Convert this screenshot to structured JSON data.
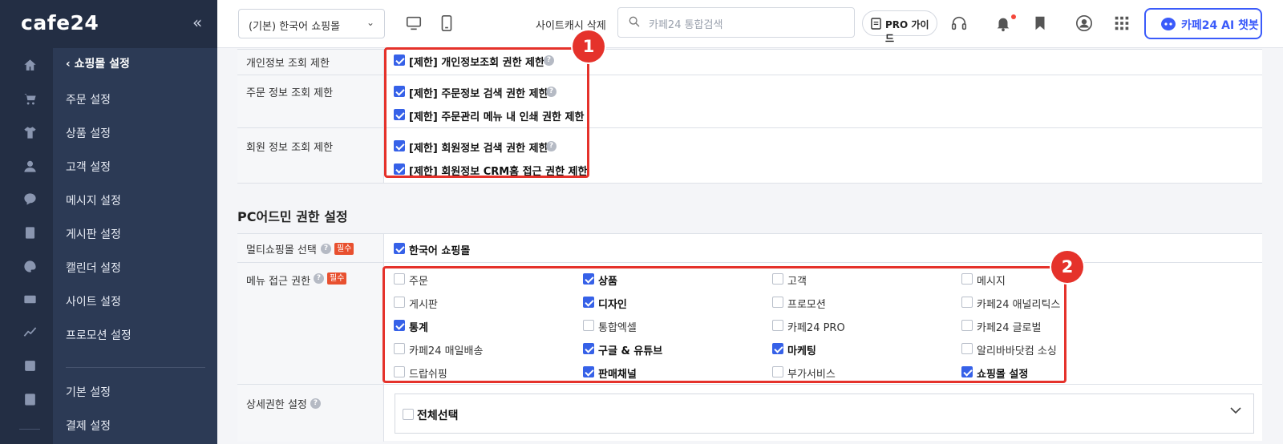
{
  "brand": {
    "logo": "cafe24",
    "collapse": "«"
  },
  "rail_icons": [
    "home-icon",
    "cart-icon",
    "shirt-icon",
    "person-icon",
    "chat-icon",
    "board-icon",
    "palette-icon",
    "promo-icon",
    "chart-line-icon",
    "chart-bar-icon",
    "excel-icon"
  ],
  "sidebar": {
    "back_label": "쇼핑몰 설정",
    "items": [
      "주문 설정",
      "상품 설정",
      "고객 설정",
      "메시지 설정",
      "게시판 설정",
      "캘린더 설정",
      "사이트 설정",
      "프로모션 설정"
    ],
    "items2": [
      "기본 설정",
      "결제 설정"
    ]
  },
  "header": {
    "mall_select": "(기본) 한국어 쇼핑몰",
    "cache_label": "사이트캐시 삭제",
    "search_placeholder": "카페24 통합검색",
    "pro_guide": "PRO 가이드",
    "ai_chatbot": "카페24 AI 챗봇"
  },
  "restriction": {
    "rows": [
      {
        "label": "개인정보 조회 제한",
        "options": [
          {
            "text": "[제한] 개인정보조회 권한 제한",
            "checked": true,
            "help": true
          }
        ]
      },
      {
        "label": "주문 정보 조회 제한",
        "options": [
          {
            "text": "[제한] 주문정보 검색 권한 제한",
            "checked": true,
            "help": true
          },
          {
            "text": "[제한] 주문관리 메뉴 내 인쇄 권한 제한",
            "checked": true,
            "help": false
          }
        ]
      },
      {
        "label": "회원 정보 조회 제한",
        "options": [
          {
            "text": "[제한] 회원정보 검색 권한 제한",
            "checked": true,
            "help": true
          },
          {
            "text": "[제한] 회원정보 CRM홈 접근 권한 제한",
            "checked": true,
            "help": false
          }
        ]
      }
    ]
  },
  "pc_admin": {
    "title": "PC어드민 권한 설정",
    "multi_label": "멀티쇼핑몰 선택",
    "required": "필수",
    "multi_option": "한국어 쇼핑몰",
    "menu_label": "메뉴 접근 권한",
    "menu_options": [
      [
        {
          "text": "주문",
          "checked": false
        },
        {
          "text": "상품",
          "checked": true
        },
        {
          "text": "고객",
          "checked": false
        },
        {
          "text": "메시지",
          "checked": false
        }
      ],
      [
        {
          "text": "게시판",
          "checked": false
        },
        {
          "text": "디자인",
          "checked": true
        },
        {
          "text": "프로모션",
          "checked": false
        },
        {
          "text": "카페24 애널리틱스",
          "checked": false
        }
      ],
      [
        {
          "text": "통계",
          "checked": true
        },
        {
          "text": "통합엑셀",
          "checked": false
        },
        {
          "text": "카페24 PRO",
          "checked": false
        },
        {
          "text": "카페24 글로벌",
          "checked": false
        }
      ],
      [
        {
          "text": "카페24 매일배송",
          "checked": false
        },
        {
          "text": "구글 & 유튜브",
          "checked": true
        },
        {
          "text": "마케팅",
          "checked": true
        },
        {
          "text": "알리바바닷컴 소싱",
          "checked": false
        }
      ],
      [
        {
          "text": "드랍쉬핑",
          "checked": false
        },
        {
          "text": "판매채널",
          "checked": true
        },
        {
          "text": "부가서비스",
          "checked": false
        },
        {
          "text": "쇼핑몰 설정",
          "checked": true
        }
      ]
    ],
    "detail_label": "상세권한 설정",
    "select_all": "전체선택"
  },
  "annotations": {
    "badge1": "1",
    "badge2": "2"
  },
  "colors": {
    "accent": "#3661e8",
    "highlight": "#e5322b",
    "sidebar": "#2c3a55"
  }
}
